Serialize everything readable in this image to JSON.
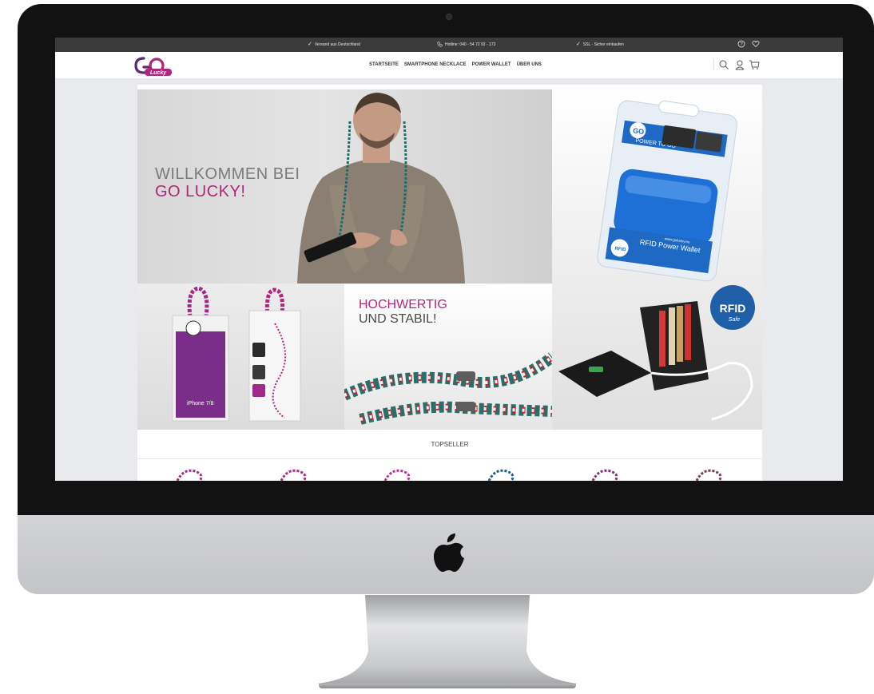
{
  "topbar": {
    "shipping": "Versand aus Deutschland",
    "hotline": "Hotline: 040 - 54 72 92 - 173",
    "ssl": "SSL - Sicher einkaufen"
  },
  "nav": {
    "items": [
      {
        "label": "STARTSEITE"
      },
      {
        "label": "SMARTPHONE NECKLACE"
      },
      {
        "label": "POWER WALLET"
      },
      {
        "label": "ÜBER UNS"
      }
    ]
  },
  "hero": {
    "line1": "WILLKOMMEN BEI",
    "line2": "GO LUCKY!"
  },
  "wallet_pack": {
    "brand": "Lucky",
    "tagline": "POWER TO GO",
    "product": "RFID Power Wallet",
    "url": "www.golucky.eu"
  },
  "packs": {
    "model": "iPhone 7/8"
  },
  "rope": {
    "line1": "HOCHWERTIG",
    "line2": "UND STABIL!"
  },
  "rfid_badge": {
    "title": "RFID",
    "sub": "Safe"
  },
  "sections": {
    "topseller": "TOPSELLER"
  },
  "colors": {
    "brand_magenta": "#b0267a",
    "topbar_bg": "#3b3b3b",
    "rfid_blue": "#1f5fa8"
  }
}
